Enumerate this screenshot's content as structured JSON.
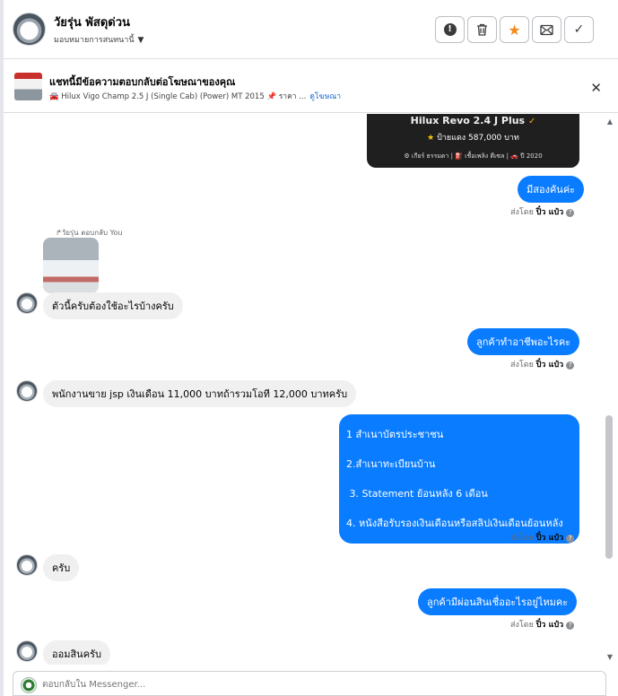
{
  "header": {
    "name": "วัยรุ่น พัสดุด่วน",
    "assign_label": "มอบหมายการสนทนานี้",
    "assign_caret": "▼",
    "buttons": [
      {
        "icon": "alert-icon",
        "glyph": "!"
      },
      {
        "icon": "trash-icon",
        "glyph": "🗑"
      },
      {
        "icon": "star-icon",
        "glyph": "★"
      },
      {
        "icon": "mail-icon",
        "glyph": "✉"
      },
      {
        "icon": "check-icon",
        "glyph": "✓"
      }
    ]
  },
  "ad_banner": {
    "title": "แชทนี้มีข้อความตอบกลับต่อโฆษณาของคุณ",
    "subtitle": "🚘 Hilux Vigo Champ 2.5 J (Single Cab) (Power) MT 2015 📌 ราคา ...",
    "link": "ดูโฆษณา",
    "close": "✕"
  },
  "ad_card": {
    "title": "Hilux Revo 2.4 J Plus",
    "badge": "✓",
    "price_line": "ป้ายแดง 587,000 บาท",
    "price_star": "★",
    "specs": "⚙ เกียร์ ธรรมดา  |  ⛽ เชื้อเพลิง ดีเซล  |  🚗 ปี 2020"
  },
  "messages": {
    "m1": "มีสองคันค่ะ",
    "reply_header": "↱วัยรุ่น ตอบกลับ You",
    "m2": "ตัวนี้ครับต้องใช้อะไรบ้างครับ",
    "m3": "ลูกค้าทำอาชีพอะไรคะ",
    "m4": "พนักงานขาย jsp เงินเดือน 11,000 บาทถ้ารวมโอที 12,000 บาทครับ",
    "m5_lines": [
      "1 สำเนาบัตรประชาชน",
      "2.สำเนาทะเบียนบ้าน",
      " 3. Statement ย้อนหลัง 6 เดือน",
      "4. หนังสือรับรองเงินเดือนหรือสลิปเงินเดือนย้อนหลัง"
    ],
    "m6": "ครับ",
    "m7": "ลูกค้ามีผ่อนสินเชื่ออะไรอยู่ไหมคะ",
    "m8": "ออมสินครับ"
  },
  "sent_by": {
    "prefix": "ส่งโดย",
    "name": "ปิ๋ว แป๋ว",
    "help": "?"
  },
  "composer": {
    "placeholder": "ตอบกลับใน Messenger..."
  },
  "colors": {
    "outgoing_bubble": "#0a7cff",
    "incoming_bubble": "#f0f0f0",
    "starred": "#f28b1e"
  }
}
